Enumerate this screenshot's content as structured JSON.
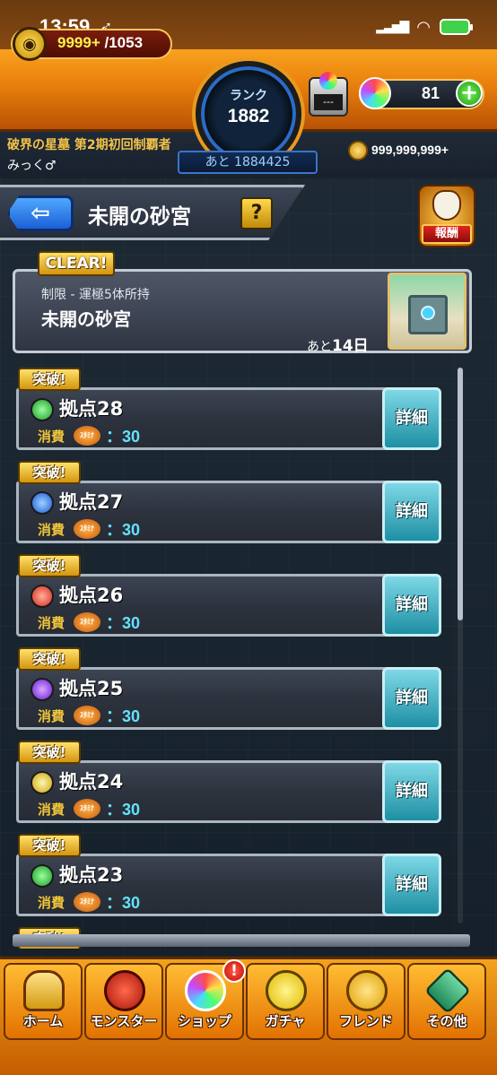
{
  "status_bar": {
    "time": "13:59",
    "signal": "▂▃▅▇"
  },
  "header": {
    "stamina_current": "9999+",
    "stamina_max": "/1053",
    "rank_label": "ランク",
    "rank_value": "1882",
    "rank_next": "あと 1884425",
    "lucky_label": "---",
    "orb_count": "81",
    "orb_plus": "+"
  },
  "player": {
    "title": "破界の星墓 第2期初回制覇者",
    "name": "みっく♂",
    "gold": "999,999,999+"
  },
  "page": {
    "back_label": "⇦",
    "title": "未開の砂宮",
    "help_label": "?",
    "reward_label": "報酬"
  },
  "quest": {
    "clear_tag": "CLEAR!",
    "restriction": "制限 - 運極5体所持",
    "name": "未開の砂宮",
    "remain_prefix": "あと",
    "remain_days": "14日"
  },
  "stages": [
    {
      "tag": "突破!",
      "name": "拠点28",
      "cost_label": "消費",
      "stamina_badge": "ｽﾀﾐﾅ",
      "cost": "：30",
      "detail": "詳細",
      "element_color": "#2ecc40"
    },
    {
      "tag": "突破!",
      "name": "拠点27",
      "cost_label": "消費",
      "stamina_badge": "ｽﾀﾐﾅ",
      "cost": "：30",
      "detail": "詳細",
      "element_color": "#2f7bff"
    },
    {
      "tag": "突破!",
      "name": "拠点26",
      "cost_label": "消費",
      "stamina_badge": "ｽﾀﾐﾅ",
      "cost": "：30",
      "detail": "詳細",
      "element_color": "#ff3b2b"
    },
    {
      "tag": "突破!",
      "name": "拠点25",
      "cost_label": "消費",
      "stamina_badge": "ｽﾀﾐﾅ",
      "cost": "：30",
      "detail": "詳細",
      "element_color": "#9b3bff"
    },
    {
      "tag": "突破!",
      "name": "拠点24",
      "cost_label": "消費",
      "stamina_badge": "ｽﾀﾐﾅ",
      "cost": "：30",
      "detail": "詳細",
      "element_color": "#f5d23a"
    },
    {
      "tag": "突破!",
      "name": "拠点23",
      "cost_label": "消費",
      "stamina_badge": "ｽﾀﾐﾅ",
      "cost": "：30",
      "detail": "詳細",
      "element_color": "#2ecc40"
    },
    {
      "tag": "突破!",
      "name": "",
      "cost_label": "",
      "stamina_badge": "",
      "cost": "",
      "detail": "",
      "element_color": "#2ecc40"
    }
  ],
  "bottom_nav": {
    "items": [
      {
        "label": "ホーム",
        "icon": "home-icon"
      },
      {
        "label": "モンスター",
        "icon": "monster-icon"
      },
      {
        "label": "ショップ",
        "icon": "shop-icon"
      },
      {
        "label": "ガチャ",
        "icon": "gacha-icon"
      },
      {
        "label": "フレンド",
        "icon": "friend-icon"
      },
      {
        "label": "その他",
        "icon": "other-icon"
      }
    ],
    "shop_badge": "!"
  }
}
